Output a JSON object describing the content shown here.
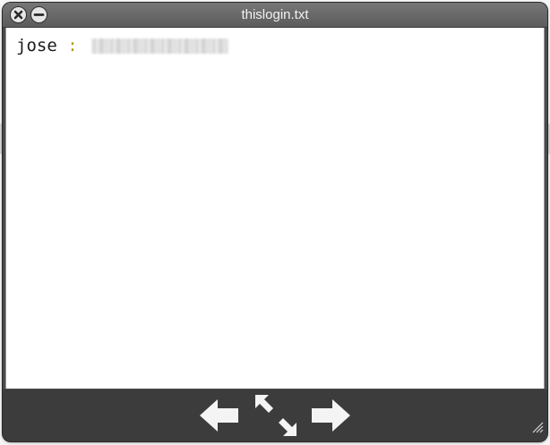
{
  "window": {
    "title": "thislogin.txt"
  },
  "titlebar_buttons": [
    {
      "name": "close",
      "icon": "close-icon"
    },
    {
      "name": "minimize",
      "icon": "minimize-icon"
    }
  ],
  "file_content": {
    "username": "jose",
    "separator": ":",
    "password_redacted": true
  },
  "toolbar": {
    "icons": [
      "arrow-left-icon",
      "expand-icon",
      "arrow-right-icon",
      "resize-grip-icon"
    ]
  },
  "colors": {
    "titlebar": "#666666",
    "toolbar": "#3c3c3c",
    "content_bg": "#ffffff",
    "separator": "#a8a000"
  }
}
